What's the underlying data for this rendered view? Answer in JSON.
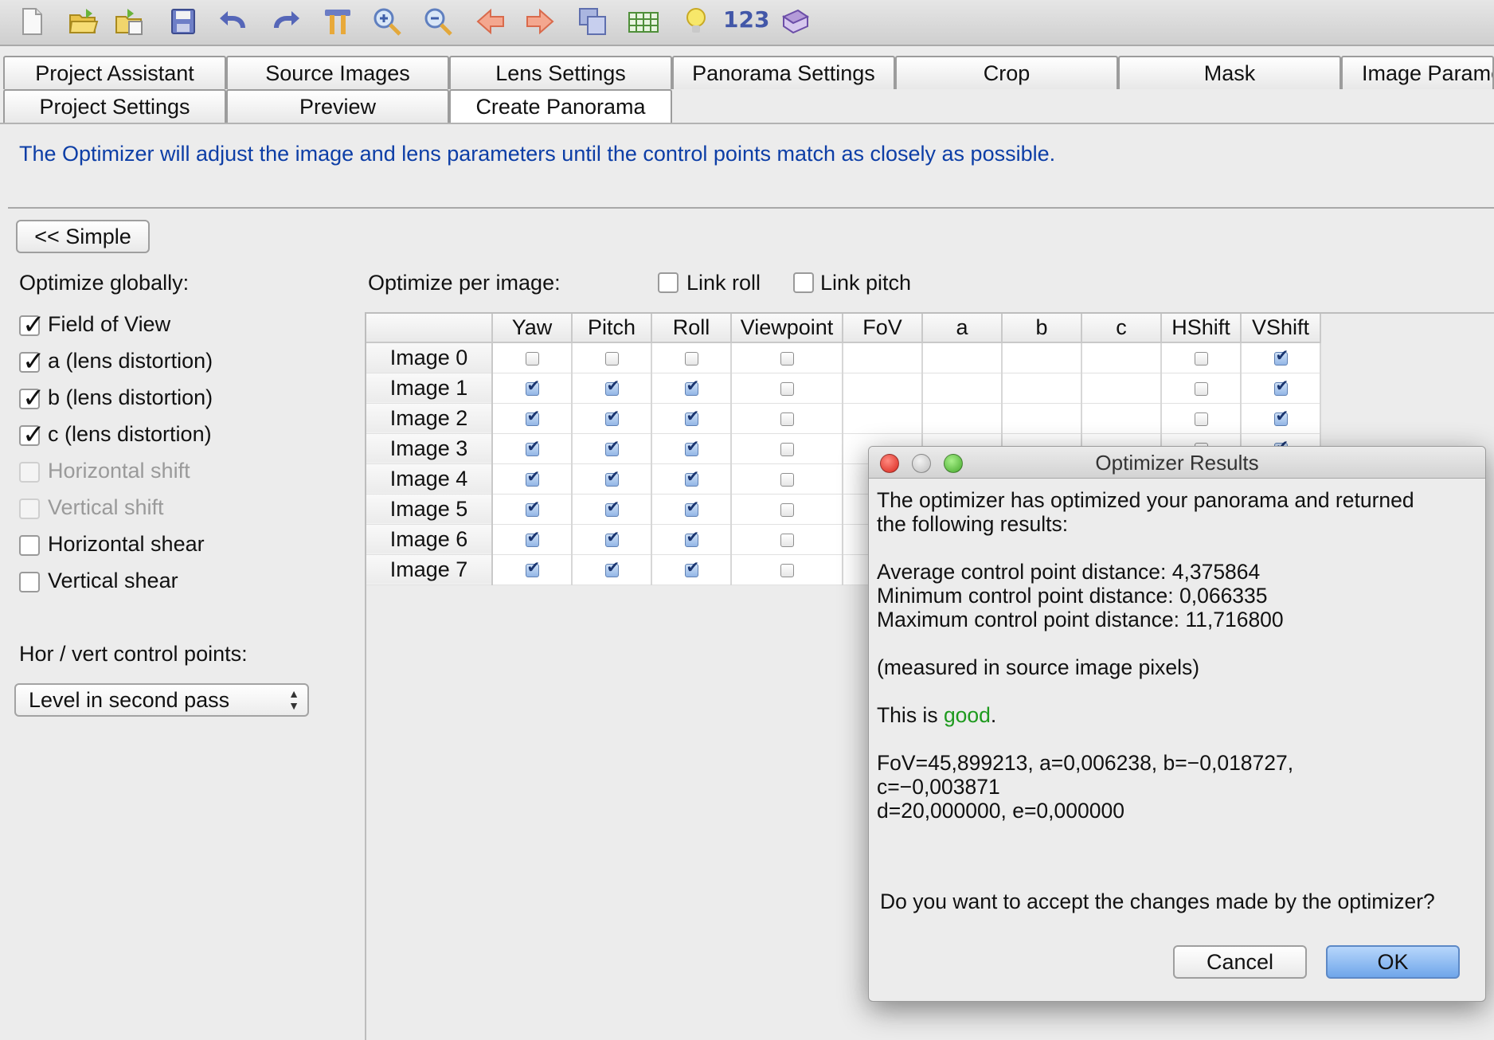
{
  "toolbar": {
    "icons": [
      "new-file-icon",
      "open-folder-icon",
      "open-recent-icon",
      "save-icon",
      "undo-icon",
      "redo-icon",
      "tools-icon",
      "zoom-in-icon",
      "zoom-out-icon",
      "previous-icon",
      "next-icon",
      "copy-images-icon",
      "table-icon",
      "lightbulb-icon",
      "numbers-icon",
      "book-icon"
    ],
    "numbers_label": "123"
  },
  "tabs": {
    "row1": [
      "Project Assistant",
      "Source Images",
      "Lens Settings",
      "Panorama Settings",
      "Crop",
      "Mask",
      "Image Parame"
    ],
    "row2": [
      "Project Settings",
      "Preview",
      "Create Panorama"
    ]
  },
  "main": {
    "intro": "The Optimizer will adjust the image and lens parameters until the control points match as closely as possible.",
    "simple_button": "<< Simple",
    "optimize_globally": "Optimize globally:",
    "global_options": [
      {
        "label": "Field of View",
        "checked": true,
        "disabled": false
      },
      {
        "label": "a (lens distortion)",
        "checked": true,
        "disabled": false
      },
      {
        "label": "b (lens distortion)",
        "checked": true,
        "disabled": false
      },
      {
        "label": "c (lens distortion)",
        "checked": true,
        "disabled": false
      },
      {
        "label": "Horizontal shift",
        "checked": false,
        "disabled": true
      },
      {
        "label": "Vertical shift",
        "checked": false,
        "disabled": true
      },
      {
        "label": "Horizontal shear",
        "checked": false,
        "disabled": false
      },
      {
        "label": "Vertical shear",
        "checked": false,
        "disabled": false
      }
    ],
    "hor_vert_label": "Hor / vert control points:",
    "hor_vert_value": "Level in second pass",
    "optimize_per_image": "Optimize per image:",
    "link_roll": "Link roll",
    "link_pitch": "Link pitch"
  },
  "grid": {
    "columns": [
      "Yaw",
      "Pitch",
      "Roll",
      "Viewpoint",
      "FoV",
      "a",
      "b",
      "c",
      "HShift",
      "VShift"
    ],
    "rows": [
      {
        "name": "Image 0",
        "yaw": false,
        "pitch": false,
        "roll": false,
        "viewpoint": false,
        "hshift": false,
        "vshift": true
      },
      {
        "name": "Image 1",
        "yaw": true,
        "pitch": true,
        "roll": true,
        "viewpoint": false,
        "hshift": false,
        "vshift": true
      },
      {
        "name": "Image 2",
        "yaw": true,
        "pitch": true,
        "roll": true,
        "viewpoint": false,
        "hshift": false,
        "vshift": true
      },
      {
        "name": "Image 3",
        "yaw": true,
        "pitch": true,
        "roll": true,
        "viewpoint": false,
        "hshift": false,
        "vshift": true
      },
      {
        "name": "Image 4",
        "yaw": true,
        "pitch": true,
        "roll": true,
        "viewpoint": false,
        "hshift": false,
        "vshift": true
      },
      {
        "name": "Image 5",
        "yaw": true,
        "pitch": true,
        "roll": true,
        "viewpoint": false,
        "hshift": false,
        "vshift": true
      },
      {
        "name": "Image 6",
        "yaw": true,
        "pitch": true,
        "roll": true,
        "viewpoint": false,
        "hshift": false,
        "vshift": true
      },
      {
        "name": "Image 7",
        "yaw": true,
        "pitch": true,
        "roll": true,
        "viewpoint": false,
        "hshift": false,
        "vshift": true
      }
    ]
  },
  "dialog": {
    "title": "Optimizer Results",
    "line1": "The optimizer has optimized your panorama and returned",
    "line2": "the following results:",
    "avg": "Average control point distance: 4,375864",
    "min": "Minimum control point distance: 0,066335",
    "max": "Maximum control point distance: 11,716800",
    "measured": "(measured in source image pixels)",
    "this_is": "This is ",
    "good": "good",
    "period": ".",
    "params1": "FoV=45,899213, a=0,006238, b=−0,018727,",
    "params2": "c=−0,003871",
    "params3": "d=20,000000, e=0,000000",
    "question": "Do you want to accept the changes made by the optimizer?",
    "cancel": "Cancel",
    "ok": "OK"
  }
}
